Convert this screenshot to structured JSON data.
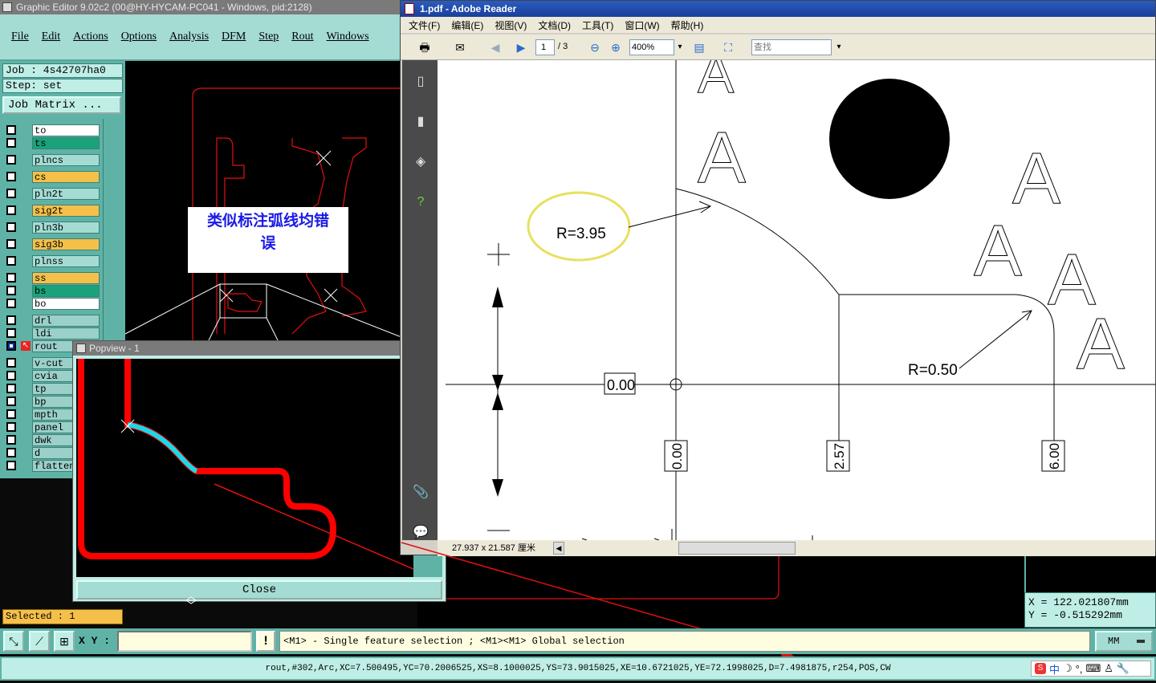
{
  "ge": {
    "title": "Graphic Editor 9.02c2 (00@HY-HYCAM-PC041 - Windows, pid:2128)",
    "menu": [
      "File",
      "Edit",
      "Actions",
      "Options",
      "Analysis",
      "DFM",
      "Step",
      "Rout",
      "Windows"
    ],
    "job": "Job : 4s42707ha0",
    "step": "Step: set",
    "job_matrix": "Job Matrix ...",
    "layers": [
      {
        "name": "to",
        "color": "#ffffff"
      },
      {
        "name": "ts",
        "color": "#1aa37a"
      },
      {
        "name": "plncs",
        "color": "#a4dcd4"
      },
      {
        "name": "cs",
        "color": "#f5c04a"
      },
      {
        "name": "pln2t",
        "color": "#a4dcd4"
      },
      {
        "name": "sig2t",
        "color": "#f5c04a"
      },
      {
        "name": "pln3b",
        "color": "#a4dcd4"
      },
      {
        "name": "sig3b",
        "color": "#f5c04a"
      },
      {
        "name": "plnss",
        "color": "#a4dcd4"
      },
      {
        "name": "ss",
        "color": "#f5c04a"
      },
      {
        "name": "bs",
        "color": "#1aa37a"
      },
      {
        "name": "bo",
        "color": "#ffffff"
      },
      {
        "name": "drl",
        "color": "#9ad0c8"
      },
      {
        "name": "ldi",
        "color": "#9ad0c8"
      },
      {
        "name": "rout",
        "color": "#9ad0c8"
      },
      {
        "name": "v-cut",
        "color": "#9ad0c8"
      },
      {
        "name": "cvia",
        "color": "#9ad0c8"
      },
      {
        "name": "tp",
        "color": "#9ad0c8"
      },
      {
        "name": "bp",
        "color": "#9ad0c8"
      },
      {
        "name": "mpth",
        "color": "#9ad0c8"
      },
      {
        "name": "panel",
        "color": "#9ad0c8"
      },
      {
        "name": "dwk",
        "color": "#9ad0c8"
      },
      {
        "name": "d",
        "color": "#9ad0c8"
      },
      {
        "name": "flatten",
        "color": "#9ad0c8"
      }
    ],
    "annotation_line1": "类似标注弧线均错",
    "annotation_line2": "误",
    "selected": "Selected : 1",
    "xy_label": "X Y :",
    "xy_value": "",
    "bang": "!",
    "message": "<M1> - Single feature selection ; <M1><M1> Global selection",
    "units": "MM",
    "coord_x": "X  =  122.021807mm",
    "coord_y": "Y  =  -0.515292mm",
    "status": "rout,#302,Arc,XC=7.500495,YC=70.2006525,XS=8.1000025,YS=73.9015025,XE=10.6721025,YE=72.1998025,D=7.4981875,r254,POS,CW",
    "ime_text": "中"
  },
  "popview": {
    "title": "Popview - 1",
    "close": "Close"
  },
  "reader": {
    "title": "1.pdf - Adobe Reader",
    "menu": [
      "文件(F)",
      "编辑(E)",
      "视图(V)",
      "文档(D)",
      "工具(T)",
      "窗口(W)",
      "帮助(H)"
    ],
    "page": "1",
    "page_total": "/ 3",
    "zoom": "400%",
    "search_placeholder": "查找",
    "page_size": "27.937 x 21.587 厘米",
    "labels": {
      "r1": "R=3.95",
      "r2": "R=0.50",
      "d0": "0.00",
      "dx0": "0.00",
      "dx1": "2.57",
      "dx2": "6.00",
      "letter": "A"
    }
  }
}
